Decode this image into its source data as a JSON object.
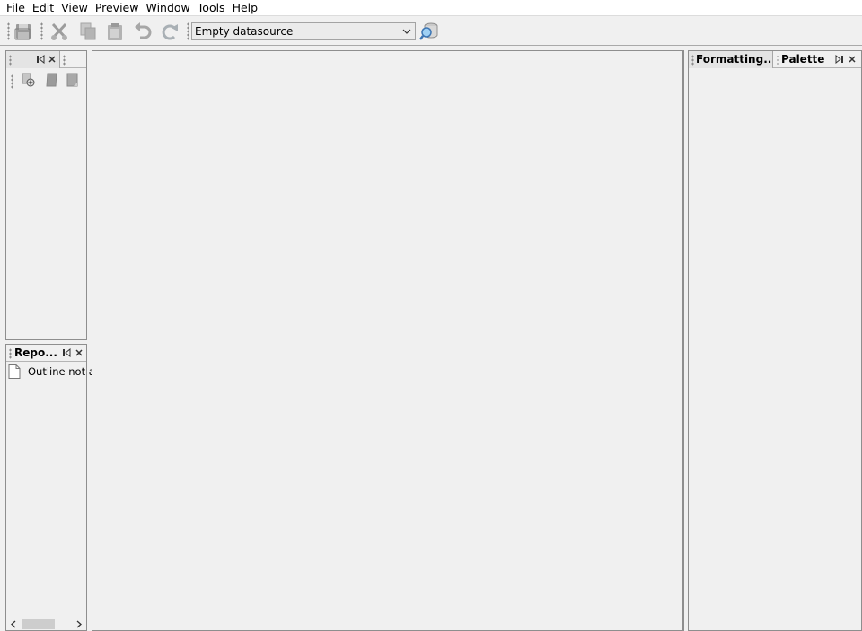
{
  "menubar": {
    "items": [
      "File",
      "Edit",
      "View",
      "Preview",
      "Window",
      "Tools",
      "Help"
    ]
  },
  "toolbar": {
    "buttons": [
      {
        "icon": "save-icon"
      },
      {
        "icon": "cut-icon"
      },
      {
        "icon": "copy-icon"
      },
      {
        "icon": "paste-icon"
      },
      {
        "icon": "undo-icon"
      },
      {
        "icon": "redo-icon"
      }
    ],
    "datasource": {
      "value": "Empty datasource"
    },
    "datasource_button_icon": "query-datasource-icon"
  },
  "left_top_panel": {
    "tab_title": "",
    "buttons": [
      {
        "icon": "add-datasource-icon"
      },
      {
        "icon": "edit-datasource-icon"
      },
      {
        "icon": "remove-datasource-icon"
      }
    ]
  },
  "report_outline_panel": {
    "tab_title": "Repo...",
    "row_text": "Outline not av"
  },
  "right_panel": {
    "tabs": [
      {
        "title": "Formatting...",
        "active": true
      },
      {
        "title": "Palette",
        "active": false
      }
    ]
  },
  "colors": {
    "background": "#f0f0f0",
    "panel_border": "#8e8e8e",
    "menubar": "#ffffff"
  }
}
